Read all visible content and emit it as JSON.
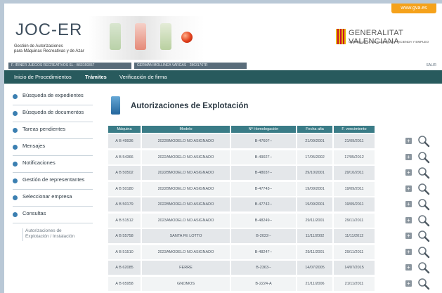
{
  "header": {
    "logo": "JOC-ER",
    "logo_sub1": "Gestión de Autorizaciones",
    "logo_sub2": "para Máquinas Recreativas y de Azar",
    "gva_tab": "www.gva.es",
    "gva_title": "GENERALITAT VALENCIANA",
    "gva_sub": "CONSELLERIA DE ECONOMÍA, HACIENDA Y EMPLEO",
    "user_company": "F. IRINER JUEGOS RECREATIVOS SL - B63159357",
    "user_name": "GERMÁN MOLLINEA VARGAS - 28631767R",
    "salir": "SALIR"
  },
  "nav": {
    "items": [
      "Inicio de Procedimientos",
      "Trámites",
      "Verificación de firma"
    ]
  },
  "sidebar": {
    "items": [
      "Búsqueda de expedientes",
      "Búsqueda de documentos",
      "Tareas pendientes",
      "Mensajes",
      "Notificaciones",
      "Gestión de representantes",
      "Seleccionar empresa",
      "Consultas"
    ],
    "sub_line1": "Autorizaciones de",
    "sub_line2": "Explotación / Instalación"
  },
  "main": {
    "page_icon_text": "",
    "title": "Autorizaciones de Explotación"
  },
  "table": {
    "headers": [
      "Máquina",
      "Modelo",
      "Nº Homologación",
      "Fecha alta",
      "F. vencimiento"
    ],
    "rows": [
      [
        "A B 49936",
        "2022BMODELO NO ASIGNADO",
        "B-47607--",
        "21/09/2001",
        "21/09/2011"
      ],
      [
        "A B 54366",
        "2022AMODELO NO ASIGNADO",
        "B-49027--",
        "17/05/2002",
        "17/05/2012"
      ],
      [
        "A B 50502",
        "2022BMODELO NO ASIGNADO",
        "B-48037--",
        "29/10/2001",
        "29/10/2011"
      ],
      [
        "A B 50180",
        "2022BMODELO NO ASIGNADO",
        "B-47743--",
        "19/09/2001",
        "19/09/2011"
      ],
      [
        "A B 50179",
        "2022BMODELO NO ASIGNADO",
        "B-47742--",
        "19/09/2001",
        "19/09/2011"
      ],
      [
        "A B 51512",
        "2023AMODELO NO ASIGNADO",
        "B-48249--",
        "29/11/2001",
        "29/11/2011"
      ],
      [
        "A B 55758",
        "SANTA FE LOTTO",
        "B-2022--",
        "11/11/2002",
        "11/11/2012"
      ],
      [
        "A B 51510",
        "2023AMODELO NO ASIGNADO",
        "B-48247--",
        "29/11/2001",
        "29/11/2011"
      ],
      [
        "A B 62085",
        "FERRE",
        "B-2363--",
        "14/07/2005",
        "14/07/2015"
      ],
      [
        "A B 65958",
        "GNOMOS",
        "B-2224-A",
        "21/11/2006",
        "21/11/2011"
      ]
    ]
  },
  "colors": {
    "navbar": "#285a5d",
    "table_header": "#3a7c87",
    "accent_blue": "#3b7fb1",
    "gva_orange": "#f5a21b"
  },
  "icons": {
    "row_add": "plus-icon",
    "row_view": "magnifier-icon",
    "bullet": "bullet-icon"
  }
}
